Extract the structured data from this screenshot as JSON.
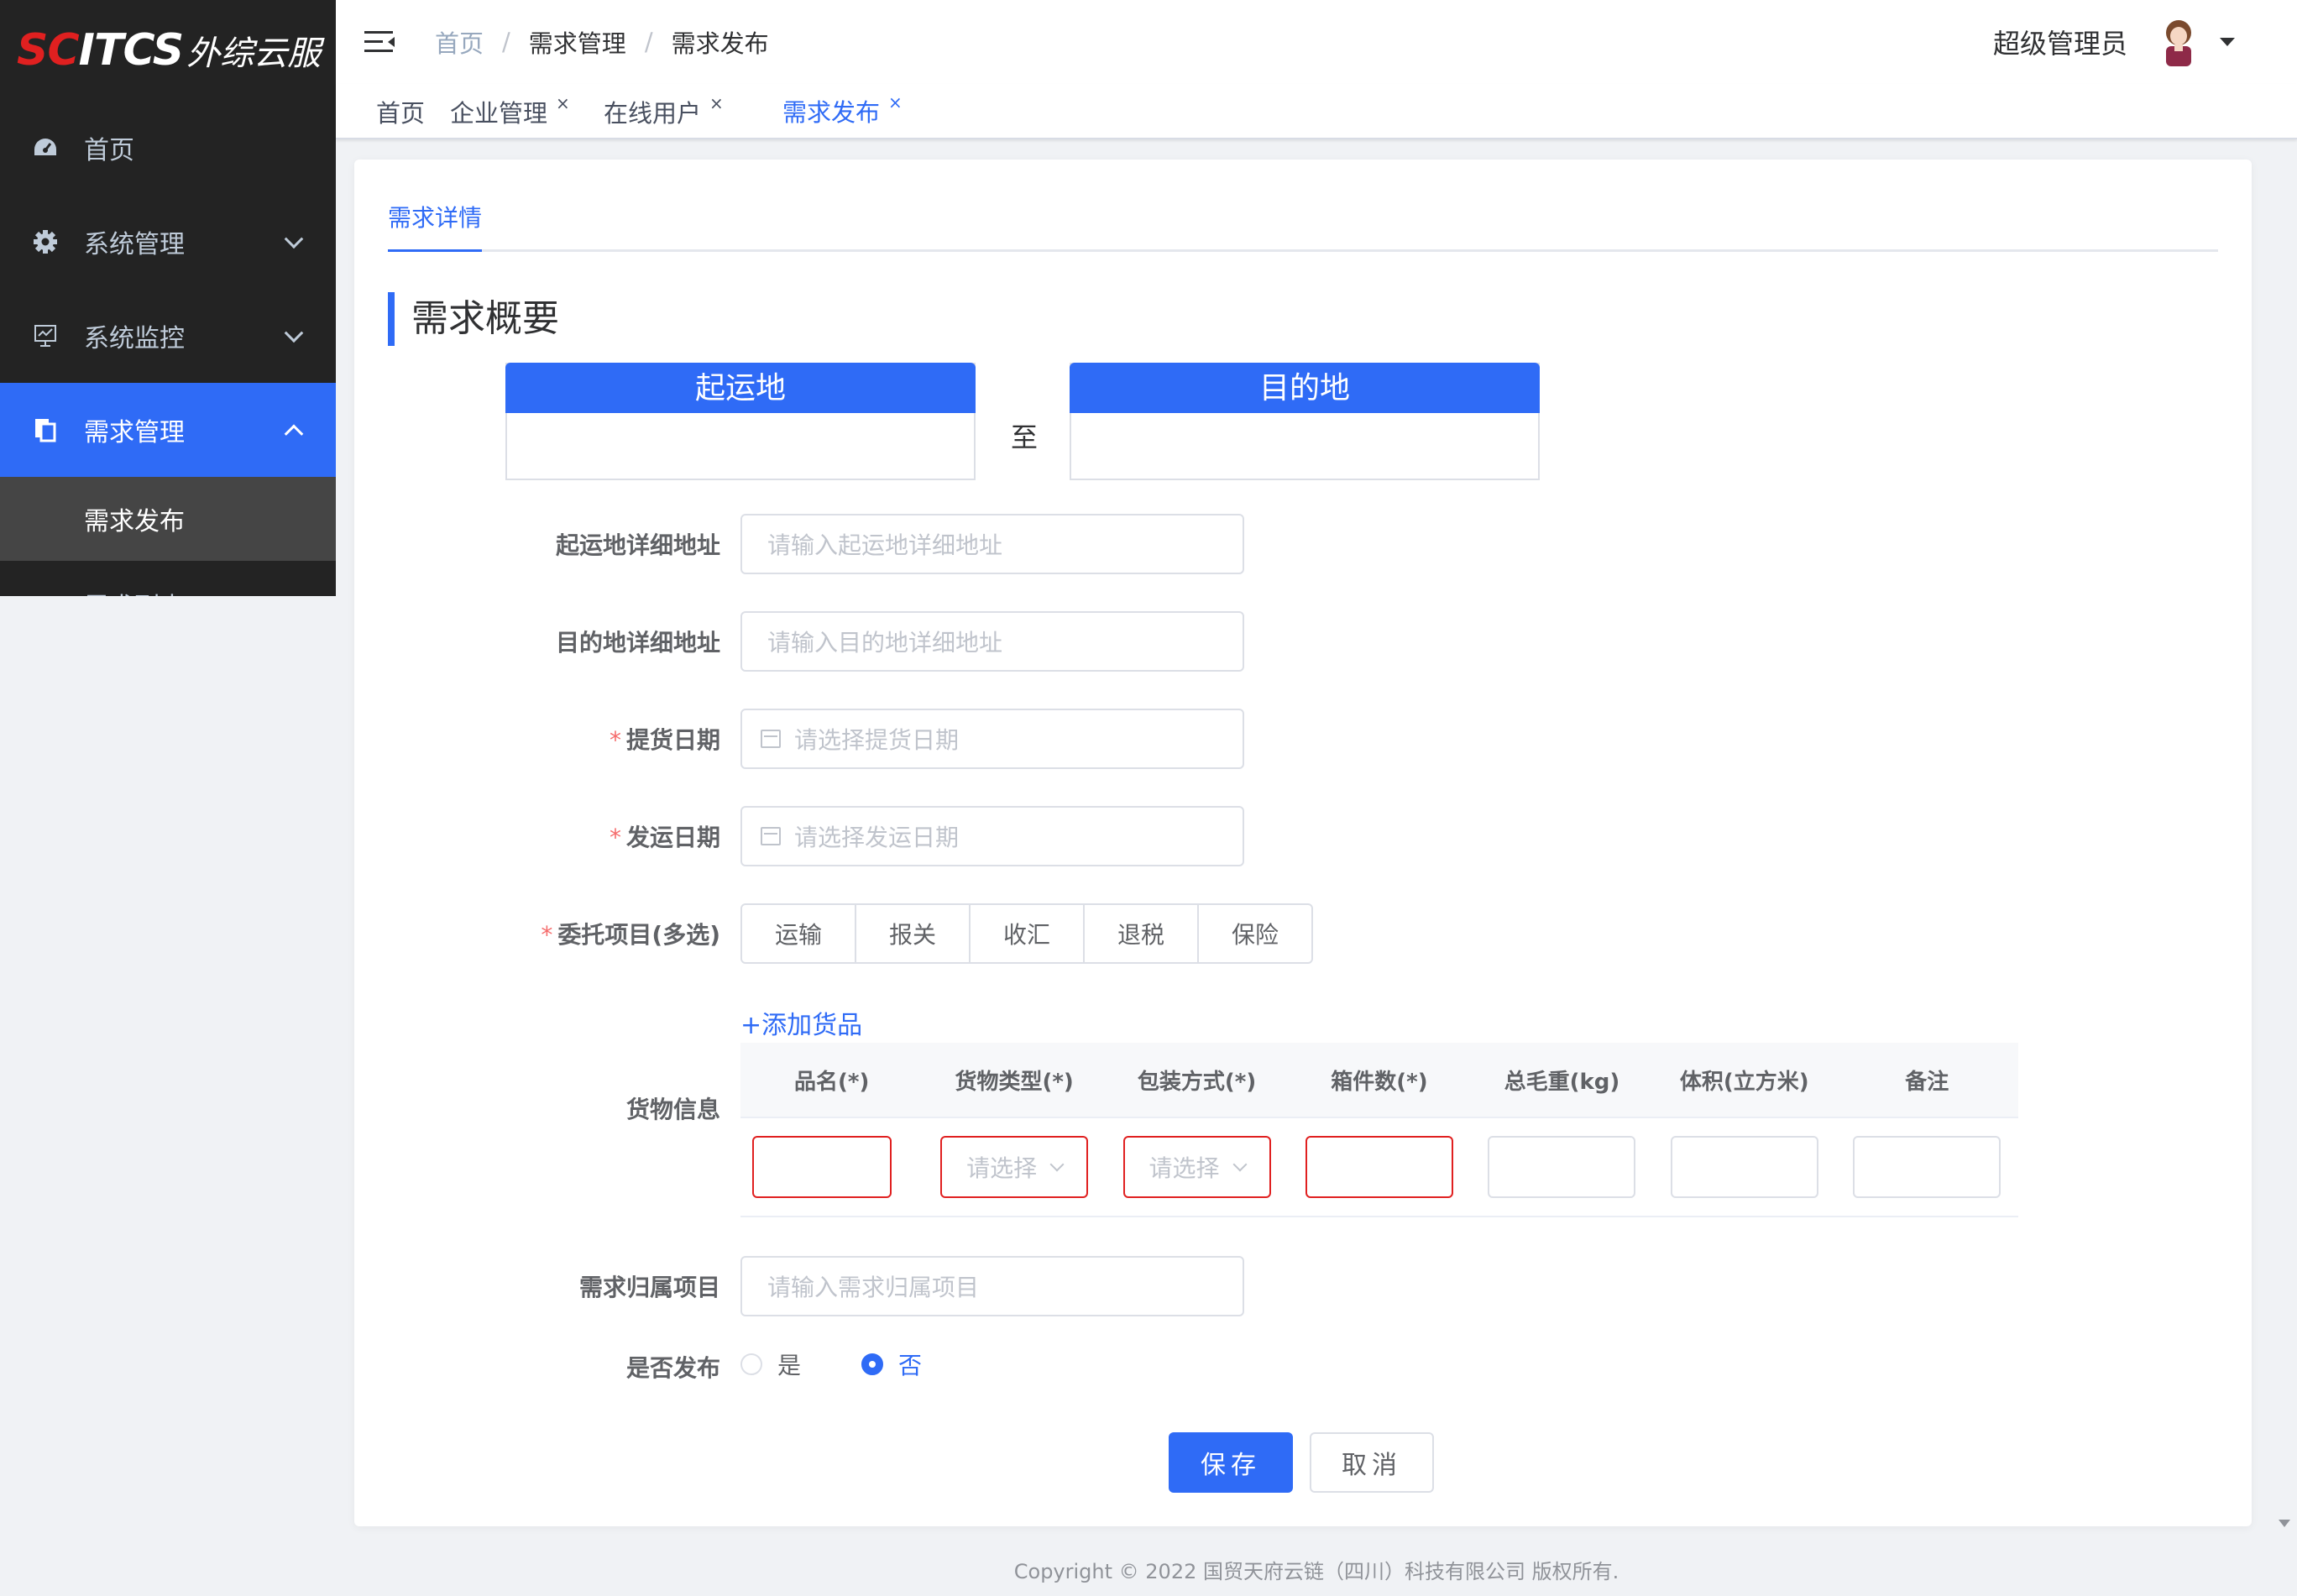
{
  "app": {
    "logo_sc": "SC",
    "logo_itcs": "ITCS",
    "logo_cn": "外综云服"
  },
  "sidebar": {
    "items": [
      {
        "label": "首页",
        "icon": "dashboard-icon"
      },
      {
        "label": "系统管理",
        "icon": "gear-icon"
      },
      {
        "label": "系统监控",
        "icon": "monitor-icon"
      },
      {
        "label": "需求管理",
        "icon": "document-icon"
      }
    ],
    "sub_items": [
      {
        "label": "需求发布"
      },
      {
        "label": "需求列表"
      }
    ]
  },
  "header": {
    "breadcrumb": [
      "首页",
      "需求管理",
      "需求发布"
    ],
    "user_name": "超级管理员"
  },
  "tags": [
    {
      "label": "首页"
    },
    {
      "label": "企业管理"
    },
    {
      "label": "在线用户"
    },
    {
      "label": "需求发布"
    }
  ],
  "form": {
    "tab_label": "需求详情",
    "section_title": "需求概要",
    "origin_label": "起运地",
    "dest_label": "目的地",
    "to_label": "至",
    "origin_address": {
      "label": "起运地详细地址",
      "placeholder": "请输入起运地详细地址"
    },
    "dest_address": {
      "label": "目的地详细地址",
      "placeholder": "请输入目的地详细地址"
    },
    "pickup_date": {
      "label": "提货日期",
      "placeholder": "请选择提货日期"
    },
    "ship_date": {
      "label": "发运日期",
      "placeholder": "请选择发运日期"
    },
    "services": {
      "label": "委托项目(多选)",
      "options": [
        "运输",
        "报关",
        "收汇",
        "退税",
        "保险"
      ]
    },
    "add_goods": "+添加货品",
    "goods_label": "货物信息",
    "goods_columns": [
      "品名(*)",
      "货物类型(*)",
      "包装方式(*)",
      "箱件数(*)",
      "总毛重(kg)",
      "体积(立方米)",
      "备注"
    ],
    "select_placeholder": "请选择",
    "project": {
      "label": "需求归属项目",
      "placeholder": "请输入需求归属项目"
    },
    "publish": {
      "label": "是否发布",
      "yes": "是",
      "no": "否",
      "selected": "否"
    },
    "save": "保存",
    "cancel": "取消",
    "required_mark": "*"
  },
  "footer": {
    "copyright": "Copyright © 2022 国贸天府云链（四川）科技有限公司 版权所有."
  },
  "colors": {
    "primary": "#2f6bf6",
    "sidebar_bg": "#232323",
    "error": "#e02020"
  }
}
